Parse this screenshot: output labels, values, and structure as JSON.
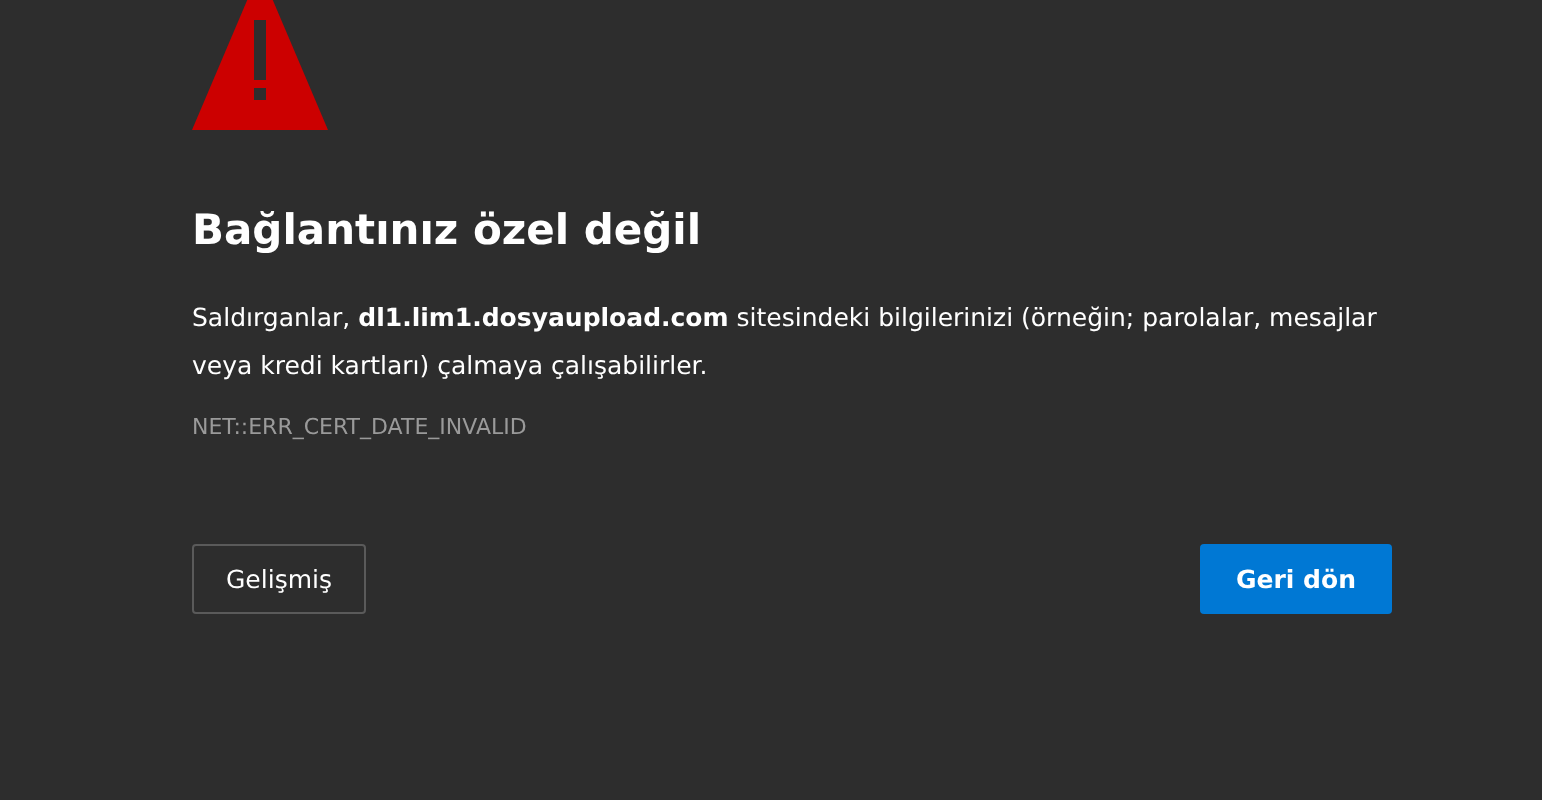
{
  "heading": "Bağlantınız özel değil",
  "message": "Saldırganlar, **dl1.lim1.dosyaupload.com** sitesindeki bilgilerinizi (örneğin; parolalar, mesajlar veya kredi kartları) çalmaya çalışabilirler.",
  "error_code": "NET::ERR_CERT_DATE_INVALID",
  "buttons": [
    {
      "label": "Gelişmiş",
      "kind": "secondary"
    },
    {
      "label": "Geri dön",
      "kind": "primary"
    }
  ]
}
